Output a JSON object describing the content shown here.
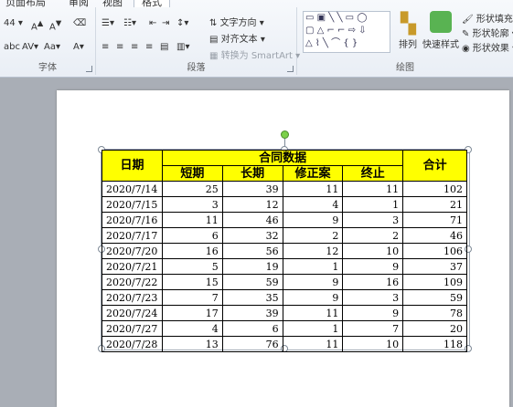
{
  "ribbon": {
    "tabs": [
      "页面布局",
      "审阅",
      "视图",
      "格式"
    ],
    "font_group": {
      "label": "字体",
      "size": "44"
    },
    "paragraph_group": {
      "label": "段落",
      "text_direction": "文字方向",
      "align_text": "对齐文本",
      "convert_smartart": "转换为 SmartArt"
    },
    "drawing_group": {
      "label": "绘图",
      "arrange": "排列",
      "quick_styles": "快速样式",
      "shape_fill": "形状填充",
      "shape_outline": "形状轮廓",
      "shape_effects": "形状效果"
    }
  },
  "table": {
    "header_date": "日期",
    "header_group": "合同数据",
    "header_total": "合计",
    "subheaders": [
      "短期",
      "长期",
      "修正案",
      "终止"
    ],
    "rows": [
      {
        "date": "2020/7/14",
        "v": [
          "25",
          "39",
          "11",
          "11"
        ],
        "total": "102"
      },
      {
        "date": "2020/7/15",
        "v": [
          "3",
          "12",
          "4",
          "1"
        ],
        "total": "21"
      },
      {
        "date": "2020/7/16",
        "v": [
          "11",
          "46",
          "9",
          "3"
        ],
        "total": "71"
      },
      {
        "date": "2020/7/17",
        "v": [
          "6",
          "32",
          "2",
          "2"
        ],
        "total": "46"
      },
      {
        "date": "2020/7/20",
        "v": [
          "16",
          "56",
          "12",
          "10"
        ],
        "total": "106"
      },
      {
        "date": "2020/7/21",
        "v": [
          "5",
          "19",
          "1",
          "9"
        ],
        "total": "37"
      },
      {
        "date": "2020/7/22",
        "v": [
          "15",
          "59",
          "9",
          "16"
        ],
        "total": "109"
      },
      {
        "date": "2020/7/23",
        "v": [
          "7",
          "35",
          "9",
          "3"
        ],
        "total": "59"
      },
      {
        "date": "2020/7/24",
        "v": [
          "17",
          "39",
          "11",
          "9"
        ],
        "total": "78"
      },
      {
        "date": "2020/7/27",
        "v": [
          "4",
          "6",
          "1",
          "7"
        ],
        "total": "20"
      },
      {
        "date": "2020/7/28",
        "v": [
          "13",
          "76",
          "11",
          "10"
        ],
        "total": "118"
      }
    ]
  },
  "colors": {
    "header_fill": "#ffff00",
    "selection_handle": "#7bd04a"
  }
}
